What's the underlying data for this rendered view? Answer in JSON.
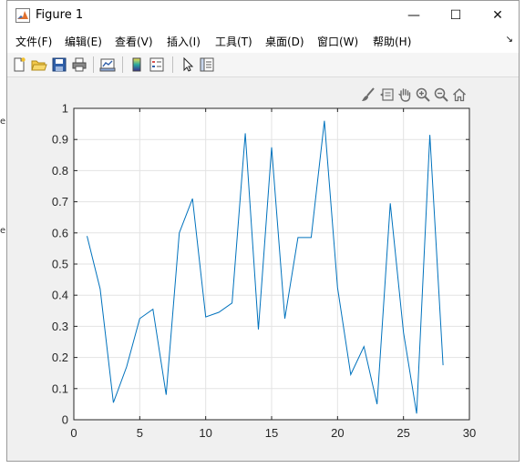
{
  "window": {
    "title": "Figure 1",
    "minimize_label": "—",
    "maximize_label": "☐",
    "close_label": "✕"
  },
  "menu": {
    "items": [
      "文件(F)",
      "编辑(E)",
      "查看(V)",
      "插入(I)",
      "工具(T)",
      "桌面(D)",
      "窗口(W)",
      "帮助(H)"
    ],
    "overflow_arrow": "↘"
  },
  "toolbar": {
    "icons": [
      "new-figure-icon",
      "open-file-icon",
      "save-icon",
      "print-icon",
      "link-plot-icon",
      "colorbar-icon",
      "legend-icon",
      "edit-plot-icon",
      "property-inspector-icon"
    ]
  },
  "axes_toolbar": {
    "icons": [
      "brush-icon",
      "data-tips-icon",
      "pan-icon",
      "zoom-in-icon",
      "zoom-out-icon",
      "home-icon"
    ]
  },
  "background_strip": {
    "fragments": [
      "e",
      "e"
    ]
  },
  "colors": {
    "line": "#0072bd",
    "grid": "#e3e3e3",
    "axes_background": "#ffffff",
    "figure_background": "#f0f0f0"
  },
  "chart_data": {
    "type": "line",
    "title": "",
    "xlabel": "",
    "ylabel": "",
    "xlim": [
      0,
      30
    ],
    "ylim": [
      0,
      1
    ],
    "grid": true,
    "xticks": [
      0,
      5,
      10,
      15,
      20,
      25,
      30
    ],
    "xtick_labels": [
      "0",
      "5",
      "10",
      "15",
      "20",
      "25",
      "30"
    ],
    "yticks": [
      0,
      0.1,
      0.2,
      0.3,
      0.4,
      0.5,
      0.6,
      0.7,
      0.8,
      0.9,
      1
    ],
    "ytick_labels": [
      "0",
      "0.1",
      "0.2",
      "0.3",
      "0.4",
      "0.5",
      "0.6",
      "0.7",
      "0.8",
      "0.9",
      "1"
    ],
    "series": [
      {
        "x": [
          1,
          2,
          3,
          4,
          5,
          6,
          7,
          8,
          9,
          10,
          11,
          12,
          13,
          14,
          15,
          16,
          17,
          18,
          19,
          20,
          21,
          22,
          23,
          24,
          25,
          26,
          27,
          28
        ],
        "values": [
          0.59,
          0.42,
          0.055,
          0.17,
          0.325,
          0.355,
          0.08,
          0.6,
          0.71,
          0.33,
          0.345,
          0.375,
          0.92,
          0.29,
          0.875,
          0.325,
          0.585,
          0.585,
          0.96,
          0.425,
          0.145,
          0.235,
          0.05,
          0.695,
          0.28,
          0.02,
          0.915,
          0.175
        ]
      }
    ]
  }
}
